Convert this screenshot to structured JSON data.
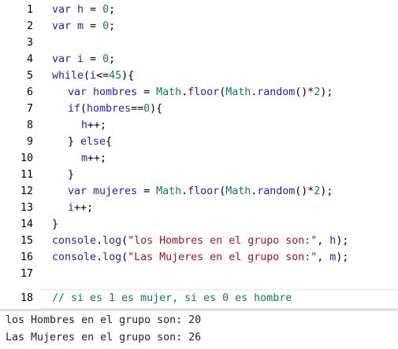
{
  "editor": {
    "lines": [
      {
        "n": "1",
        "parts": [
          [
            "kw",
            "var "
          ],
          [
            "id",
            "h"
          ],
          [
            "plain",
            " = "
          ],
          [
            "num",
            "0"
          ],
          [
            "plain",
            ";"
          ]
        ]
      },
      {
        "n": "2",
        "parts": [
          [
            "kw",
            "var "
          ],
          [
            "id",
            "m"
          ],
          [
            "plain",
            " = "
          ],
          [
            "num",
            "0"
          ],
          [
            "plain",
            ";"
          ]
        ]
      },
      {
        "n": "3",
        "parts": []
      },
      {
        "n": "4",
        "parts": [
          [
            "kw",
            "var "
          ],
          [
            "id",
            "i"
          ],
          [
            "plain",
            " = "
          ],
          [
            "num",
            "0"
          ],
          [
            "plain",
            ";"
          ]
        ]
      },
      {
        "n": "5",
        "parts": [
          [
            "kw",
            "while"
          ],
          [
            "plain",
            "("
          ],
          [
            "id",
            "i"
          ],
          [
            "plain",
            "<="
          ],
          [
            "num",
            "45"
          ],
          [
            "plain",
            "){"
          ]
        ]
      },
      {
        "n": "6",
        "indent": 1,
        "parts": [
          [
            "kw",
            "var "
          ],
          [
            "id",
            "hombres"
          ],
          [
            "plain",
            " = "
          ],
          [
            "fn",
            "Math"
          ],
          [
            "plain",
            "."
          ],
          [
            "id",
            "floor"
          ],
          [
            "plain",
            "("
          ],
          [
            "fn",
            "Math"
          ],
          [
            "plain",
            "."
          ],
          [
            "id",
            "random"
          ],
          [
            "plain",
            "()*"
          ],
          [
            "num",
            "2"
          ],
          [
            "plain",
            ");"
          ]
        ]
      },
      {
        "n": "7",
        "indent": 1,
        "parts": [
          [
            "kw",
            "if"
          ],
          [
            "plain",
            "("
          ],
          [
            "id",
            "hombres"
          ],
          [
            "plain",
            "=="
          ],
          [
            "num",
            "0"
          ],
          [
            "plain",
            "){"
          ]
        ]
      },
      {
        "n": "8",
        "indent": 2,
        "parts": [
          [
            "id",
            "h"
          ],
          [
            "plain",
            "++;"
          ]
        ]
      },
      {
        "n": "9",
        "indent": 1,
        "parts": [
          [
            "plain",
            "} "
          ],
          [
            "kw",
            "else"
          ],
          [
            "plain",
            "{"
          ]
        ]
      },
      {
        "n": "10",
        "indent": 2,
        "parts": [
          [
            "id",
            "m"
          ],
          [
            "plain",
            "++;"
          ]
        ]
      },
      {
        "n": "11",
        "indent": 1,
        "parts": [
          [
            "plain",
            "}"
          ]
        ]
      },
      {
        "n": "12",
        "indent": 1,
        "parts": [
          [
            "kw",
            "var "
          ],
          [
            "id",
            "mujeres"
          ],
          [
            "plain",
            " = "
          ],
          [
            "fn",
            "Math"
          ],
          [
            "plain",
            "."
          ],
          [
            "id",
            "floor"
          ],
          [
            "plain",
            "("
          ],
          [
            "fn",
            "Math"
          ],
          [
            "plain",
            "."
          ],
          [
            "id",
            "random"
          ],
          [
            "plain",
            "()*"
          ],
          [
            "num",
            "2"
          ],
          [
            "plain",
            ");"
          ]
        ]
      },
      {
        "n": "13",
        "indent": 1,
        "parts": [
          [
            "id",
            "i"
          ],
          [
            "plain",
            "++;"
          ]
        ]
      },
      {
        "n": "14",
        "parts": [
          [
            "plain",
            "}"
          ]
        ]
      },
      {
        "n": "15",
        "parts": [
          [
            "id",
            "console"
          ],
          [
            "plain",
            "."
          ],
          [
            "id",
            "log"
          ],
          [
            "plain",
            "("
          ],
          [
            "str",
            "\"los Hombres en el grupo son:\""
          ],
          [
            "plain",
            ", "
          ],
          [
            "id",
            "h"
          ],
          [
            "plain",
            ");"
          ]
        ]
      },
      {
        "n": "16",
        "parts": [
          [
            "id",
            "console"
          ],
          [
            "plain",
            "."
          ],
          [
            "id",
            "log"
          ],
          [
            "plain",
            "("
          ],
          [
            "str",
            "\"Las Mujeres en el grupo son:\""
          ],
          [
            "plain",
            ", "
          ],
          [
            "id",
            "m"
          ],
          [
            "plain",
            ");"
          ]
        ]
      },
      {
        "n": "17",
        "parts": []
      },
      {
        "n": "18",
        "parts": [
          [
            "cm",
            "// si es 1 es mujer, si es 0 es hombre"
          ]
        ]
      }
    ]
  },
  "console": {
    "output": [
      "los Hombres en el grupo son: 20",
      "Las Mujeres en el grupo son: 26"
    ]
  },
  "colors": {
    "keyword": "#1f1fb4",
    "identifier": "#1f1fb4",
    "builtin": "#117a5c",
    "number": "#117a5c",
    "string": "#a31515",
    "comment": "#117a5c"
  }
}
